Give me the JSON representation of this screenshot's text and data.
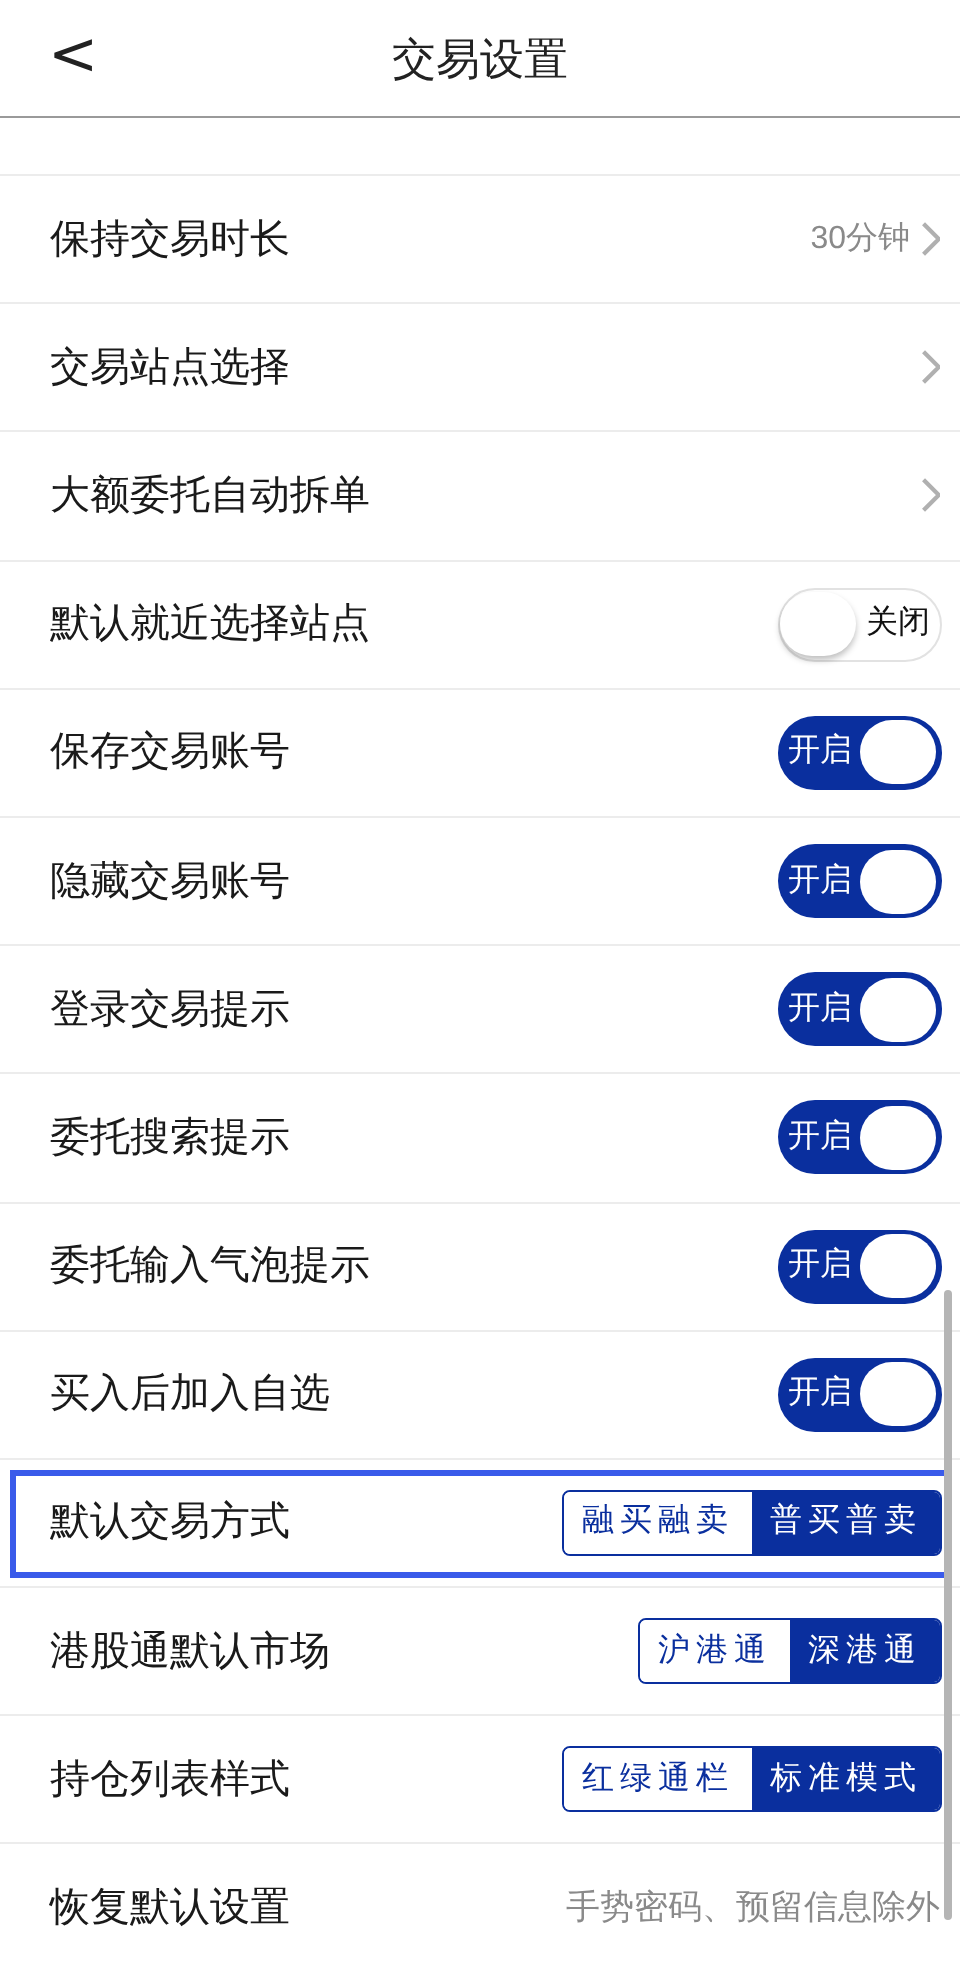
{
  "header": {
    "back": "<",
    "title": "交易设置"
  },
  "rows": [
    {
      "kind": "link",
      "label": "保持交易时长",
      "value": "30分钟"
    },
    {
      "kind": "link",
      "label": "交易站点选择"
    },
    {
      "kind": "link",
      "label": "大额委托自动拆单"
    },
    {
      "kind": "toggle",
      "label": "默认就近选择站点",
      "on": false,
      "state_text": "关闭"
    },
    {
      "kind": "toggle",
      "label": "保存交易账号",
      "on": true,
      "state_text": "开启"
    },
    {
      "kind": "toggle",
      "label": "隐藏交易账号",
      "on": true,
      "state_text": "开启"
    },
    {
      "kind": "toggle",
      "label": "登录交易提示",
      "on": true,
      "state_text": "开启"
    },
    {
      "kind": "toggle",
      "label": "委托搜索提示",
      "on": true,
      "state_text": "开启"
    },
    {
      "kind": "toggle",
      "label": "委托输入气泡提示",
      "on": true,
      "state_text": "开启"
    },
    {
      "kind": "toggle",
      "label": "买入后加入自选",
      "on": true,
      "state_text": "开启"
    },
    {
      "kind": "segmented",
      "label": "默认交易方式",
      "highlighted": true,
      "options": [
        {
          "label": "融买融卖",
          "selected": false
        },
        {
          "label": "普买普卖",
          "selected": true
        }
      ]
    },
    {
      "kind": "segmented",
      "label": "港股通默认市场",
      "highlighted": false,
      "options": [
        {
          "label": "沪港通",
          "selected": false
        },
        {
          "label": "深港通",
          "selected": true
        }
      ]
    },
    {
      "kind": "segmented",
      "label": "持仓列表样式",
      "highlighted": false,
      "options": [
        {
          "label": "红绿通栏",
          "selected": false
        },
        {
          "label": "标准模式",
          "selected": true
        }
      ]
    },
    {
      "kind": "note",
      "label": "恢复默认设置",
      "value": "手势密码、预留信息除外"
    }
  ]
}
